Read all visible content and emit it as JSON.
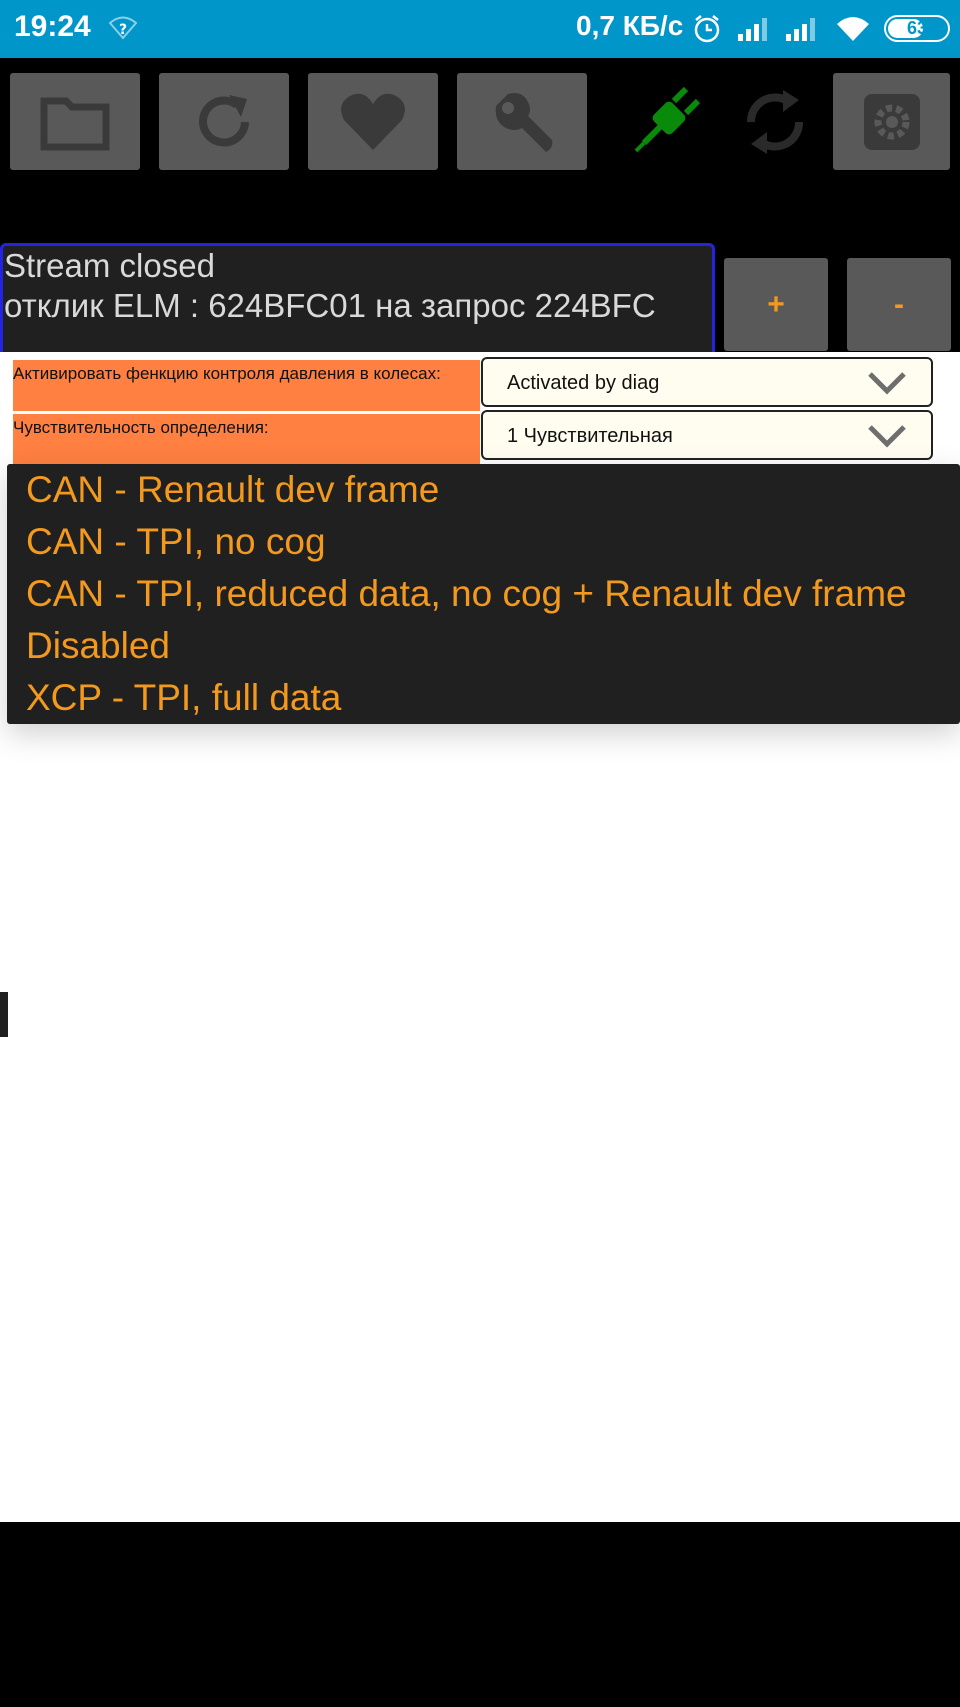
{
  "status_bar": {
    "time": "19:24",
    "network_speed": "0,7 КБ/с",
    "battery_level": "63",
    "icons": [
      "wifi-question-icon",
      "alarm-icon",
      "signal-icon",
      "signal-icon",
      "wifi-icon",
      "battery-icon"
    ]
  },
  "toolbar": {
    "buttons": [
      "folder-icon",
      "refresh-icon",
      "heart-icon",
      "wrench-icon",
      "plug-icon",
      "sync-icon",
      "settings-icon"
    ],
    "plug_color": "#0a8a0a"
  },
  "log": {
    "lines": [
      "Stream closed",
      "отклик ELM : 624BFC01 на запрос 224BFC"
    ]
  },
  "zoom": {
    "plus": "+",
    "minus": "-"
  },
  "params": [
    {
      "label": "Активировать фенкцию контроля давления в колесах:",
      "value": "Activated by diag"
    },
    {
      "label": "Чувствительность определения:",
      "value": "1 Чувствительная"
    }
  ],
  "dropdown": {
    "options": [
      "CAN - Renault dev frame",
      "CAN - TPI, no cog",
      "CAN - TPI, reduced data, no cog  + Renault dev frame",
      "Disabled",
      "XCP - TPI, full data"
    ]
  },
  "colors": {
    "status_bar": "#0196c9",
    "accent_orange": "#f39a1e",
    "label_orange": "#ff8040",
    "button_gray": "#595959",
    "log_border": "#2424e0"
  }
}
